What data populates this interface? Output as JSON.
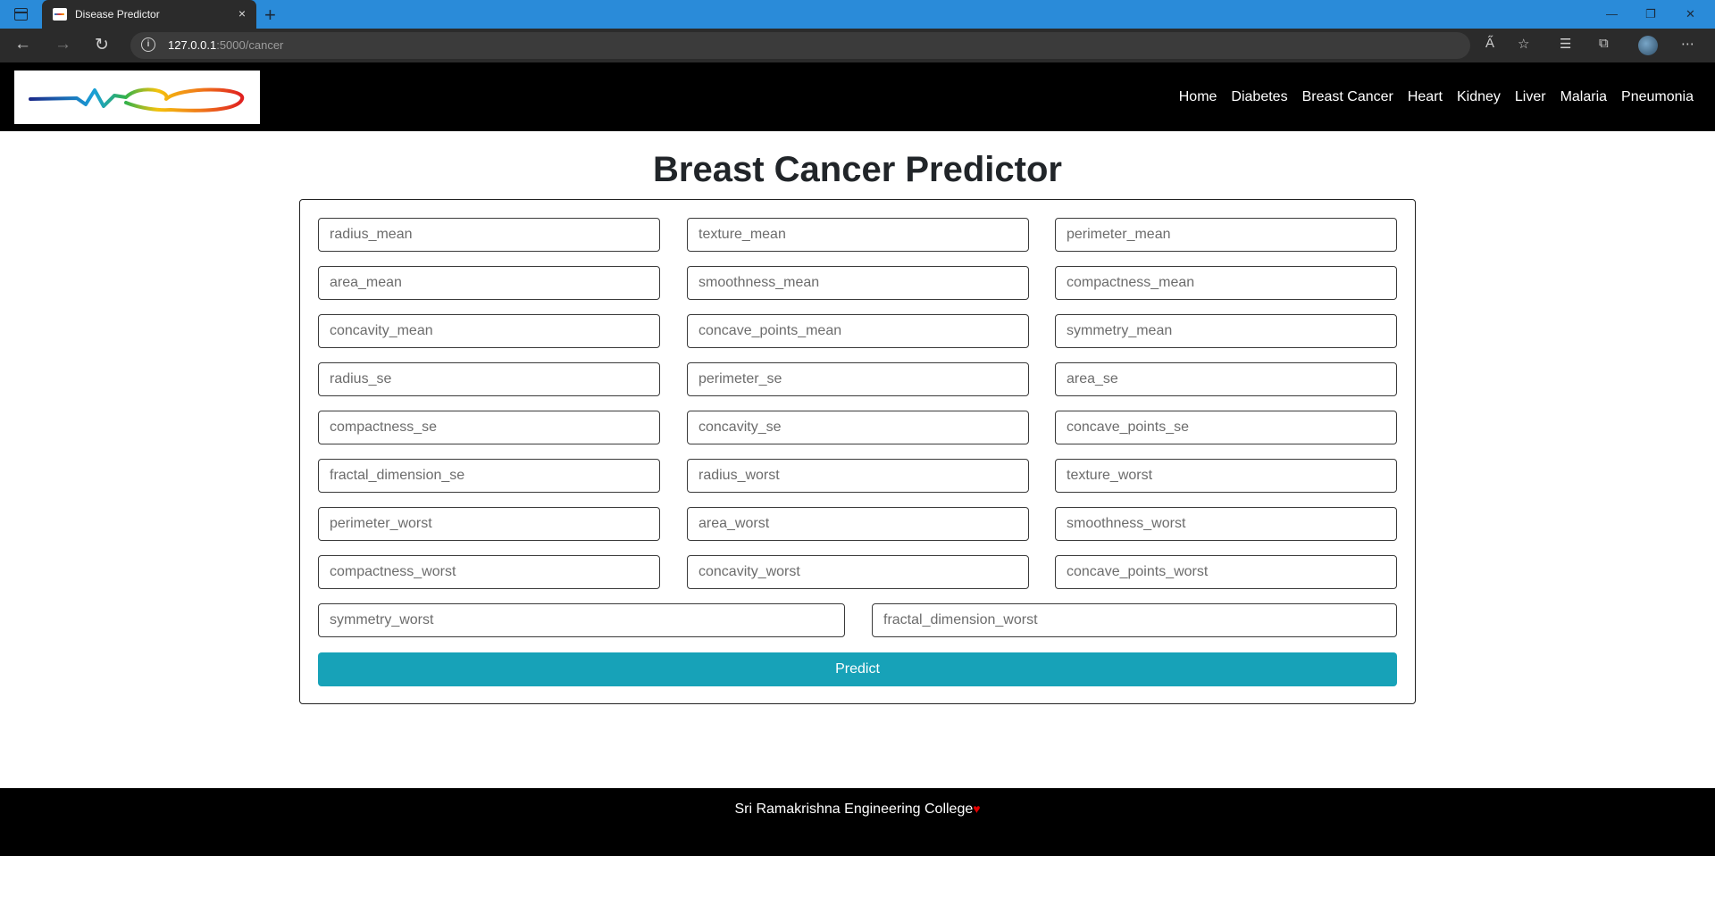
{
  "browser": {
    "tab_title": "Disease Predictor",
    "tab_close": "×",
    "new_tab": "+",
    "url_host": "127.0.0.1",
    "url_rest": ":5000/cancer",
    "window_controls": [
      "—",
      "❐",
      "✕"
    ]
  },
  "navbar": {
    "links": [
      "Home",
      "Diabetes",
      "Breast Cancer",
      "Heart",
      "Kidney",
      "Liver",
      "Malaria",
      "Pneumonia"
    ]
  },
  "main": {
    "title": "Breast Cancer Predictor",
    "fields": [
      "radius_mean",
      "texture_mean",
      "perimeter_mean",
      "area_mean",
      "smoothness_mean",
      "compactness_mean",
      "concavity_mean",
      "concave_points_mean",
      "symmetry_mean",
      "radius_se",
      "perimeter_se",
      "area_se",
      "compactness_se",
      "concavity_se",
      "concave_points_se",
      "fractal_dimension_se",
      "radius_worst",
      "texture_worst",
      "perimeter_worst",
      "area_worst",
      "smoothness_worst",
      "compactness_worst",
      "concavity_worst",
      "concave_points_worst",
      "symmetry_worst",
      "fractal_dimension_worst"
    ],
    "predict_label": "Predict"
  },
  "footer": {
    "text": "Sri Ramakrishna Engineering College",
    "heart": "♥"
  },
  "colors": {
    "accent_button": "#17a2b8",
    "navbar_bg": "#000000",
    "titlebar_bg": "#2a8bd9"
  }
}
